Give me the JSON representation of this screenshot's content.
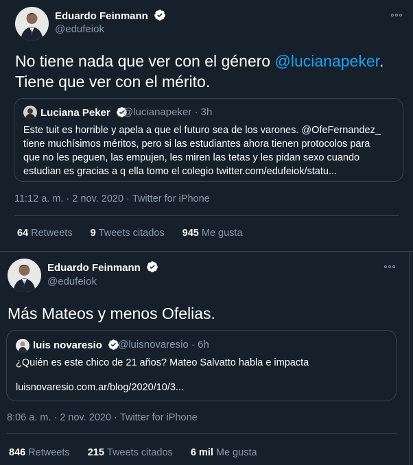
{
  "tweets": [
    {
      "author": {
        "name": "Eduardo Feinmann",
        "handle": "@edufeiok"
      },
      "text_before": "No tiene nada que ver con el género ",
      "mention": "@lucianapeker",
      "text_after": ".\nTiene que ver con el mérito.",
      "quote": {
        "name": "Luciana Peker",
        "handle": "@lucianapeker",
        "sep": "·",
        "time": "3h",
        "lines": [
          "Este tuit es horrible y apela a que el futuro sea de los varones. @OfeFernandez_",
          "tiene muchísimos méritos, pero si las estudiantes ahora tienen protocolos para",
          "que no les peguen, las empujen, les miren las tetas y les pidan sexo cuando",
          "estudian es gracias a q ella tomo el colegio twitter.com/edufeiok/statu..."
        ]
      },
      "time": "11:12 a. m.",
      "date": "2 nov. 2020",
      "source": "Twitter for iPhone",
      "stats": {
        "retweets_num": "64",
        "retweets_label": "Retweets",
        "quotes_num": "9",
        "quotes_label": "Tweets citados",
        "likes_num": "945",
        "likes_label": "Me gusta"
      }
    },
    {
      "author": {
        "name": "Eduardo Feinmann",
        "handle": "@edufeiok"
      },
      "text": "Más Mateos y menos Ofelias.",
      "quote": {
        "name": "luis novaresio",
        "handle": "@luisnovaresio",
        "sep": "·",
        "time": "6h",
        "line1": "¿Quién es este chico de 21 años? Mateo Salvatto habla e impacta",
        "line2": "luisnovaresio.com.ar/blog/2020/10/3..."
      },
      "time": "8:06 a. m.",
      "date": "2 nov. 2020",
      "source": "Twitter for iPhone",
      "stats": {
        "retweets_num": "846",
        "retweets_label": "Retweets",
        "quotes_num": "215",
        "quotes_label": "Tweets citados",
        "likes_num": "6 mil",
        "likes_label": "Me gusta"
      }
    }
  ],
  "colors": {
    "background": "#15202b",
    "border": "#38444d",
    "secondary_text": "#8899a6",
    "accent": "#1da1f2"
  },
  "icons": {
    "verified": "verified-badge-icon",
    "more": "more-options-icon"
  },
  "separators": {
    "dot": "·"
  }
}
